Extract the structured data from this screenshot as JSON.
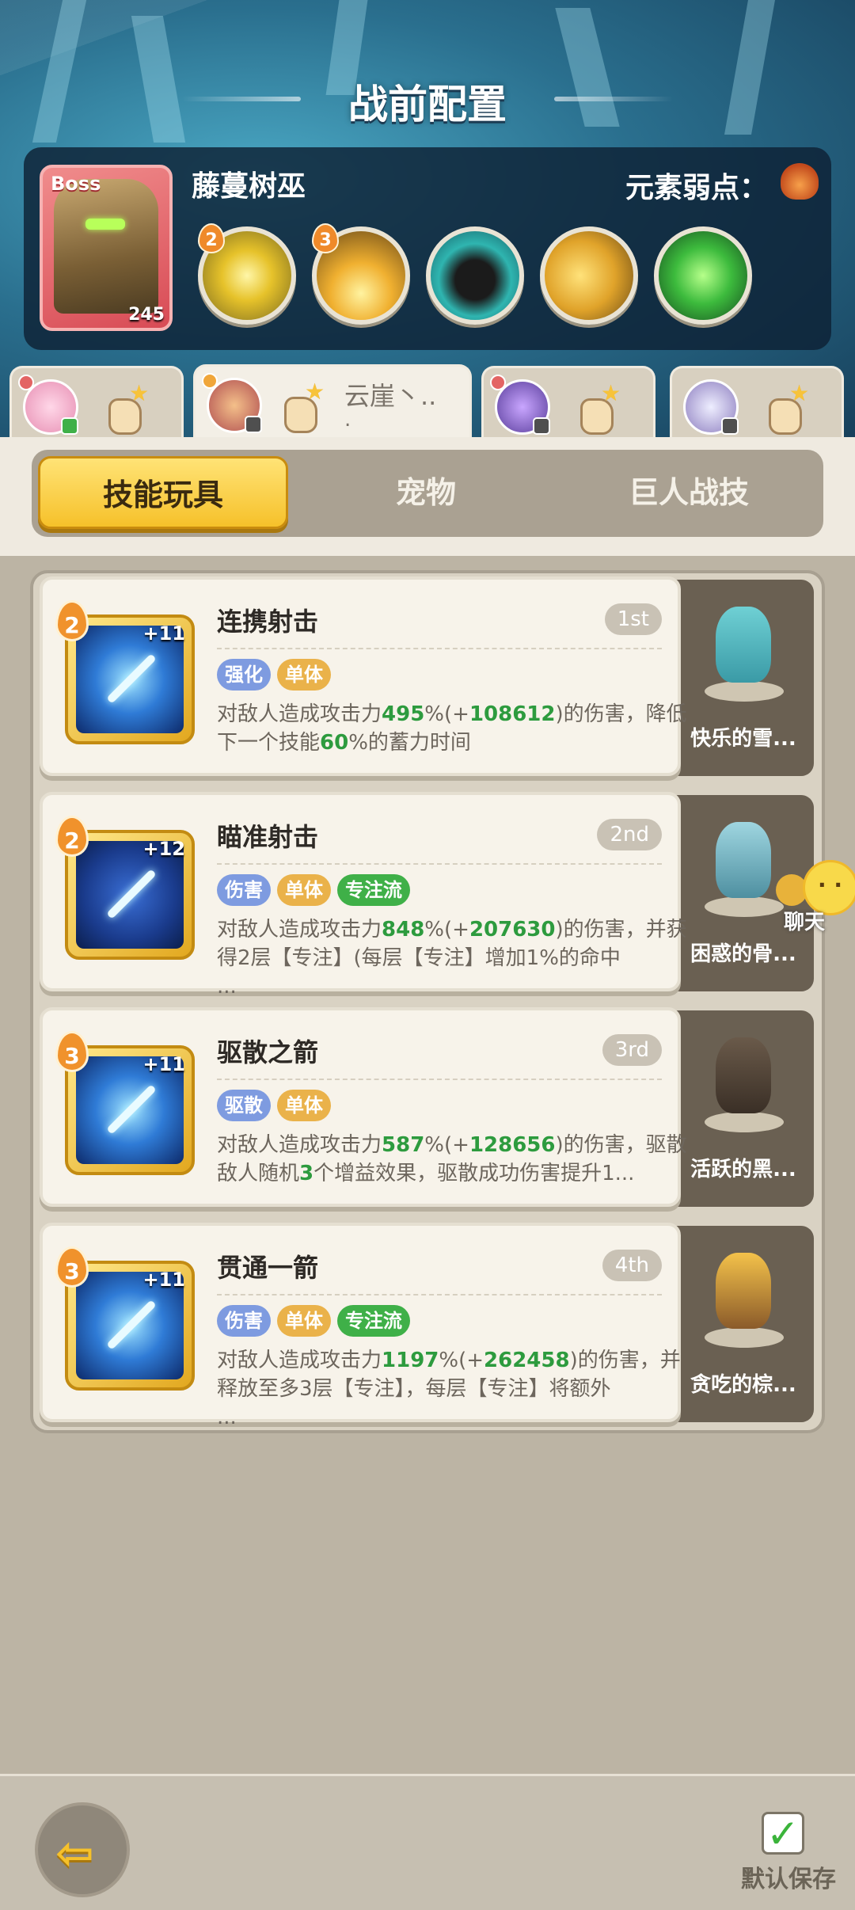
{
  "header": {
    "title": "战前配置"
  },
  "boss": {
    "tag": "Boss",
    "level": "245",
    "name": "藤蔓树巫",
    "weakness_label": "元素弱点：",
    "skills": [
      {
        "badge": "2",
        "icon": "yellow-burst-icon"
      },
      {
        "badge": "3",
        "icon": "fire-field-icon"
      },
      {
        "badge": "",
        "icon": "black-monster-icon"
      },
      {
        "badge": "",
        "icon": "gold-claw-icon"
      },
      {
        "badge": "",
        "icon": "green-slime-icon"
      }
    ]
  },
  "team_tabs": [
    {
      "name": "",
      "active": false
    },
    {
      "name": "云崖丶..",
      "dot": ".",
      "active": true
    },
    {
      "name": "",
      "active": false
    },
    {
      "name": "",
      "active": false
    }
  ],
  "segments": {
    "skills": "技能玩具",
    "pets": "宠物",
    "giant": "巨人战技",
    "active": "skills"
  },
  "skills": [
    {
      "name": "连携射击",
      "rank": "1st",
      "level": "2",
      "plus": "+11",
      "tags": [
        {
          "label": "强化",
          "color": "blue"
        },
        {
          "label": "单体",
          "color": "orange"
        }
      ],
      "desc": [
        "对敌人造成攻击力",
        "495",
        "%(+",
        "108612",
        ")的伤害，降低下一个技能",
        "60",
        "%的蓄力时间"
      ],
      "pet": "快乐的雪..."
    },
    {
      "name": "瞄准射击",
      "rank": "2nd",
      "level": "2",
      "plus": "+12",
      "tags": [
        {
          "label": "伤害",
          "color": "blue"
        },
        {
          "label": "单体",
          "color": "orange"
        },
        {
          "label": "专注流",
          "color": "green"
        }
      ],
      "desc": [
        "对敌人造成攻击力",
        "848",
        "%(+",
        "207630",
        ")的伤害，并获得2层【专注】(每层【专注】增加1%的命中",
        "",
        "..."
      ],
      "pet": "困惑的骨..."
    },
    {
      "name": "驱散之箭",
      "rank": "3rd",
      "level": "3",
      "plus": "+11",
      "tags": [
        {
          "label": "驱散",
          "color": "blue"
        },
        {
          "label": "单体",
          "color": "orange"
        }
      ],
      "desc": [
        "对敌人造成攻击力",
        "587",
        "%(+",
        "128656",
        ")的伤害，驱散敌人随机",
        "3",
        "个增益效果，驱散成功伤害提升1..."
      ],
      "pet": "活跃的黑..."
    },
    {
      "name": "贯通一箭",
      "rank": "4th",
      "level": "3",
      "plus": "+11",
      "tags": [
        {
          "label": "伤害",
          "color": "blue"
        },
        {
          "label": "单体",
          "color": "orange"
        },
        {
          "label": "专注流",
          "color": "green"
        }
      ],
      "desc": [
        "对敌人造成攻击力",
        "1197",
        "%(+",
        "262458",
        ")的伤害，并释放至多3层【专注】，每层【专注】将额外",
        "",
        "..."
      ],
      "pet": "贪吃的棕..."
    }
  ],
  "chat": {
    "label": "聊天"
  },
  "footer": {
    "save_label": "默认保存"
  }
}
